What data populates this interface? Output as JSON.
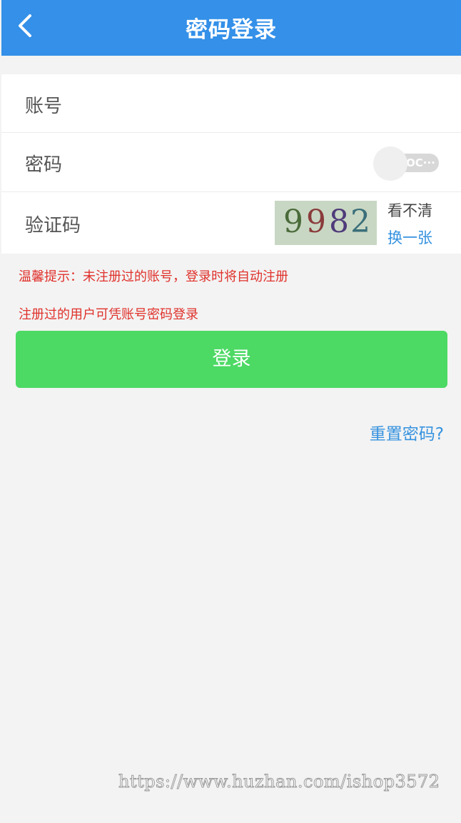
{
  "header": {
    "title": "密码登录",
    "back_icon": "chevron-left-icon"
  },
  "form": {
    "account": {
      "label": "账号",
      "value": "",
      "placeholder": ""
    },
    "password": {
      "label": "密码",
      "value": "",
      "placeholder": "",
      "toggle_text": "OC···",
      "toggle_on": false
    },
    "captcha": {
      "label": "验证码",
      "digits": [
        {
          "char": "9",
          "color": "#4a6b3a"
        },
        {
          "char": "9",
          "color": "#8a3b3b"
        },
        {
          "char": "8",
          "color": "#4f3b7a"
        },
        {
          "char": "2",
          "color": "#3b6f7a"
        }
      ],
      "unclear_text": "看不清",
      "refresh_text": "换一张"
    }
  },
  "tips": {
    "line1": "温馨提示：未注册过的账号，登录时将自动注册",
    "line2": "注册过的用户可凭账号密码登录"
  },
  "login_button": "登录",
  "reset_link": "重置密码?",
  "watermark": "https://www.huzhan.com/ishop3572",
  "colors": {
    "header": "#3490e8",
    "login": "#4cd964",
    "tip": "#e0312b",
    "link": "#3592df"
  }
}
